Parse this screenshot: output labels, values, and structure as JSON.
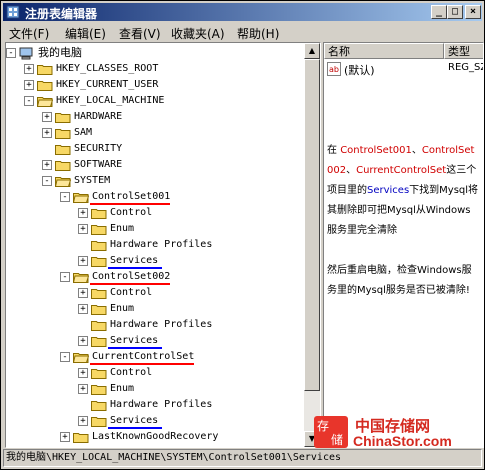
{
  "window": {
    "title": "注册表编辑器"
  },
  "menu": [
    "文件(F)",
    "编辑(E)",
    "查看(V)",
    "收藏夹(A)",
    "帮助(H)"
  ],
  "tree": {
    "root": "我的电脑",
    "keys": [
      "HKEY_CLASSES_ROOT",
      "HKEY_CURRENT_USER",
      "HKEY_LOCAL_MACHINE"
    ],
    "hklm_children": [
      "HARDWARE",
      "SAM",
      "SECURITY",
      "SOFTWARE",
      "SYSTEM"
    ],
    "controlsets": [
      "ControlSet001",
      "ControlSet002",
      "CurrentControlSet"
    ],
    "cs_children": [
      "Control",
      "Enum",
      "Hardware Profiles",
      "Services"
    ],
    "last": "LastKnownGoodRecovery"
  },
  "list": {
    "columns": [
      "名称",
      "类型"
    ],
    "row_name": "(默认)",
    "row_type": "REG_SZ"
  },
  "note": {
    "p1": [
      "在 ",
      "ControlSet001",
      "、",
      "ControlSet002",
      "、",
      "CurrentControlSet",
      "这三个项目里的",
      "Services",
      "下找到Mysql将其删除即可把Mysql从Windows服务里完全清除"
    ],
    "p2": "然后重启电脑，检查Windows服务里的Mysql服务是否已被清除!"
  },
  "status": "我的电脑\\HKEY_LOCAL_MACHINE\\SYSTEM\\ControlSet001\\Services",
  "watermark": {
    "cn": "中国存储网",
    "en": "ChinaStor.com",
    "logo": "存储"
  },
  "colors": {
    "title_start": "#0a246a",
    "title_end": "#a6caf0",
    "highlight": "#d00000",
    "underline_red": "#ff0000",
    "underline_blue": "#0000ff",
    "folder": "#f7d865"
  }
}
